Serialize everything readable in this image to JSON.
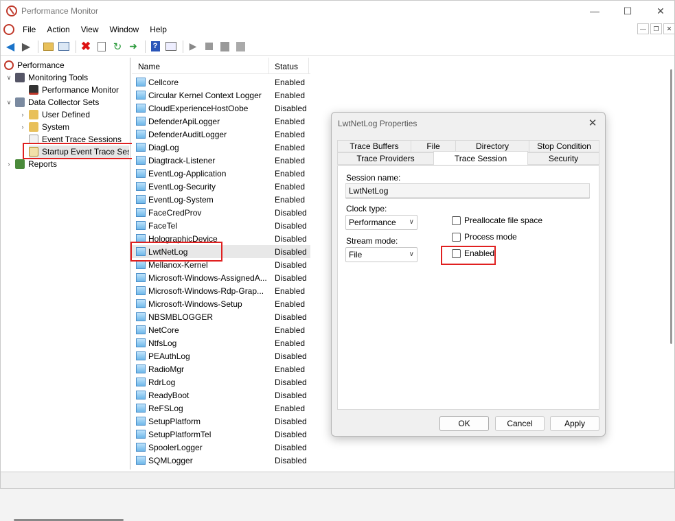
{
  "window": {
    "title": "Performance Monitor"
  },
  "menu": [
    "File",
    "Action",
    "View",
    "Window",
    "Help"
  ],
  "toolbar": {
    "icons": [
      "back-icon",
      "forward-icon",
      "up-folder-icon",
      "show-hide-tree-icon",
      "delete-icon",
      "properties-icon",
      "refresh-icon",
      "export-icon",
      "help-icon",
      "mmc-icon",
      "start-icon",
      "stop-icon",
      "new-icon",
      "disabled-icon"
    ]
  },
  "tree": {
    "root": "Performance",
    "monitoring_tools": "Monitoring Tools",
    "performance_monitor": "Performance Monitor",
    "data_collector_sets": "Data Collector Sets",
    "user_defined": "User Defined",
    "system": "System",
    "event_trace_sessions": "Event Trace Sessions",
    "startup_event_trace": "Startup Event Trace Ses",
    "reports": "Reports"
  },
  "list": {
    "columns": {
      "name": "Name",
      "status": "Status"
    },
    "rows": [
      {
        "name": "Cellcore",
        "status": "Enabled"
      },
      {
        "name": "Circular Kernel Context Logger",
        "status": "Enabled"
      },
      {
        "name": "CloudExperienceHostOobe",
        "status": "Disabled"
      },
      {
        "name": "DefenderApiLogger",
        "status": "Enabled"
      },
      {
        "name": "DefenderAuditLogger",
        "status": "Enabled"
      },
      {
        "name": "DiagLog",
        "status": "Enabled"
      },
      {
        "name": "Diagtrack-Listener",
        "status": "Enabled"
      },
      {
        "name": "EventLog-Application",
        "status": "Enabled"
      },
      {
        "name": "EventLog-Security",
        "status": "Enabled"
      },
      {
        "name": "EventLog-System",
        "status": "Enabled"
      },
      {
        "name": "FaceCredProv",
        "status": "Disabled"
      },
      {
        "name": "FaceTel",
        "status": "Disabled"
      },
      {
        "name": "HolographicDevice",
        "status": "Disabled"
      },
      {
        "name": "LwtNetLog",
        "status": "Disabled"
      },
      {
        "name": "Mellanox-Kernel",
        "status": "Disabled"
      },
      {
        "name": "Microsoft-Windows-AssignedA...",
        "status": "Disabled"
      },
      {
        "name": "Microsoft-Windows-Rdp-Grap...",
        "status": "Enabled"
      },
      {
        "name": "Microsoft-Windows-Setup",
        "status": "Enabled"
      },
      {
        "name": "NBSMBLOGGER",
        "status": "Disabled"
      },
      {
        "name": "NetCore",
        "status": "Enabled"
      },
      {
        "name": "NtfsLog",
        "status": "Enabled"
      },
      {
        "name": "PEAuthLog",
        "status": "Disabled"
      },
      {
        "name": "RadioMgr",
        "status": "Enabled"
      },
      {
        "name": "RdrLog",
        "status": "Disabled"
      },
      {
        "name": "ReadyBoot",
        "status": "Disabled"
      },
      {
        "name": "ReFSLog",
        "status": "Enabled"
      },
      {
        "name": "SetupPlatform",
        "status": "Disabled"
      },
      {
        "name": "SetupPlatformTel",
        "status": "Disabled"
      },
      {
        "name": "SpoolerLogger",
        "status": "Disabled"
      },
      {
        "name": "SQMLogger",
        "status": "Disabled"
      }
    ],
    "selected_index": 13
  },
  "dialog": {
    "title": "LwtNetLog Properties",
    "tabs_row1": [
      "Trace Buffers",
      "File",
      "Directory",
      "Stop Condition"
    ],
    "tabs_row2": [
      "Trace Providers",
      "Trace Session",
      "Security"
    ],
    "active_tab": "Trace Session",
    "session_name_label": "Session name:",
    "session_name_value": "LwtNetLog",
    "clock_type_label": "Clock type:",
    "clock_type_value": "Performance",
    "stream_mode_label": "Stream mode:",
    "stream_mode_value": "File",
    "preallocate_label": "Preallocate file space",
    "process_mode_label": "Process mode",
    "enabled_label": "Enabled",
    "ok": "OK",
    "cancel": "Cancel",
    "apply": "Apply"
  },
  "colors": {
    "highlight": "#e02020",
    "list_icon": "#6fb8ea"
  }
}
